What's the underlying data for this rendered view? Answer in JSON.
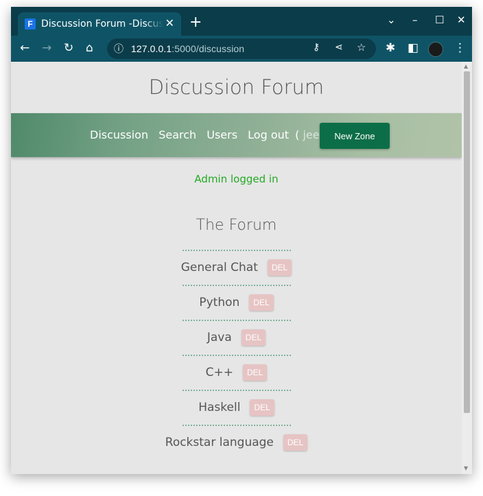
{
  "browser": {
    "tab_title": "Discussion Forum -Discussion",
    "favicon_letter": "F",
    "url_host": "127.0.0.1",
    "url_path": ":5000/discussion",
    "icons": [
      "back-icon",
      "forward-icon",
      "reload-icon",
      "home-icon",
      "info-icon",
      "key-icon",
      "share-icon",
      "star-icon",
      "extensions-icon",
      "sidepanel-icon",
      "profile-avatar",
      "menu-icon",
      "new-tab-icon",
      "minimize-icon",
      "maximize-icon",
      "close-icon",
      "tab-close-icon",
      "chevron-down-icon"
    ]
  },
  "site": {
    "title": "Discussion Forum",
    "nav": {
      "discussion": "Discussion",
      "search": "Search",
      "users": "Users",
      "logout": "Log out",
      "user_open": "(",
      "user": "jee",
      "user_close": ")"
    },
    "new_zone_label": "New Zone",
    "status": "Admin logged in",
    "forum_heading": "The Forum",
    "del_label": "DEL",
    "zones": [
      "General Chat",
      "Python",
      "Java",
      "C++",
      "Haskell",
      "Rockstar language"
    ]
  },
  "colors": {
    "browser_frame": "#0b3c4a",
    "nav_gradient_start": "#4f8a6a",
    "nav_gradient_end": "#b0c3a8",
    "new_zone_button": "#0c6e48",
    "status_text": "#22aa22",
    "del_button": "#e7c4c4"
  }
}
